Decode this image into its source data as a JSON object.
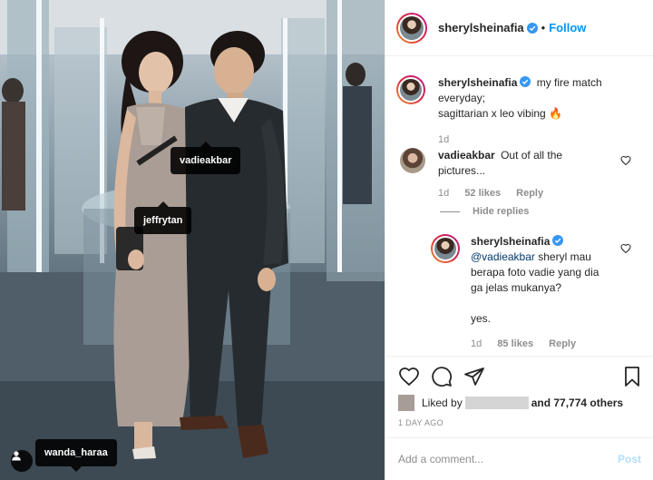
{
  "post": {
    "author": "sherylsheinafia",
    "follow_label": "Follow",
    "separator": "•",
    "caption_lines": [
      "my fire match",
      "everyday;",
      "sagittarian x leo vibing 🔥"
    ],
    "caption_time": "1d"
  },
  "photo": {
    "tags": [
      "vadieakbar",
      "jeffrytan",
      "wanda_haraa"
    ]
  },
  "comments": [
    {
      "username": "vadieakbar",
      "text_lines": [
        "Out of all the",
        "pictures..."
      ],
      "time": "1d",
      "likes": "52 likes",
      "reply_label": "Reply"
    },
    {
      "username": "sherylsheinafia",
      "mention": "@vadieakbar",
      "text_lines": [
        " sheryl mau",
        "berapa foto vadie yang dia",
        "ga jelas mukanya?",
        "",
        "yes."
      ],
      "time": "1d",
      "likes": "85 likes",
      "reply_label": "Reply"
    }
  ],
  "hide_replies_label": "Hide replies",
  "likes": {
    "prefix": "Liked by",
    "suffix": "and 77,774 others"
  },
  "date_label": "1 DAY AGO",
  "add_comment": {
    "placeholder": "Add a comment...",
    "post_label": "Post"
  },
  "colors": {
    "accent": "#0095f6",
    "fire": "#f0522c",
    "muted": "#8e8e8e"
  },
  "icons": [
    "heart-icon",
    "comment-icon",
    "share-icon",
    "bookmark-icon",
    "verified-icon",
    "user-tag-icon"
  ]
}
